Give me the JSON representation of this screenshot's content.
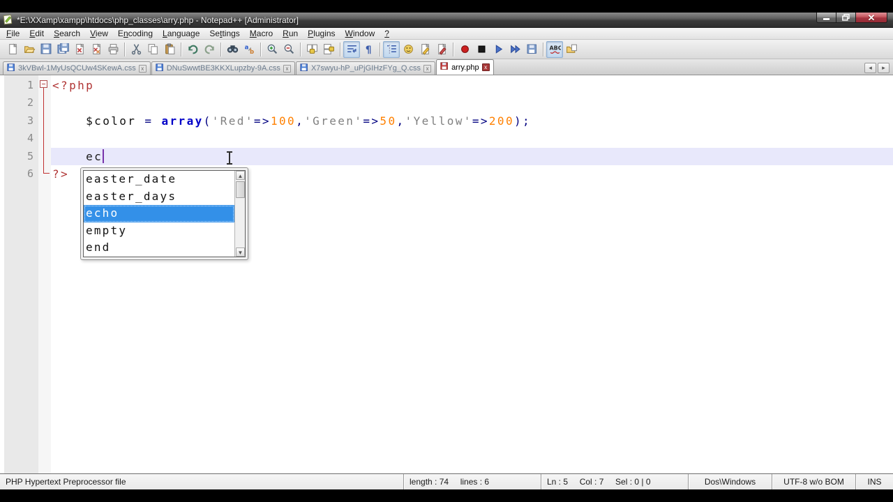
{
  "titlebar": {
    "title": "*E:\\XXamp\\xampp\\htdocs\\php_classes\\arry.php - Notepad++ [Administrator]",
    "buttons": [
      {
        "name": "minimize"
      },
      {
        "name": "restore"
      },
      {
        "name": "close"
      }
    ]
  },
  "menubar": {
    "items": [
      {
        "label": "File",
        "underline_index": 0
      },
      {
        "label": "Edit",
        "underline_index": 0
      },
      {
        "label": "Search",
        "underline_index": 0
      },
      {
        "label": "View",
        "underline_index": 0
      },
      {
        "label": "Encoding",
        "underline_index": 1
      },
      {
        "label": "Language",
        "underline_index": 0
      },
      {
        "label": "Settings",
        "underline_index": 2
      },
      {
        "label": "Macro",
        "underline_index": 0
      },
      {
        "label": "Run",
        "underline_index": 0
      },
      {
        "label": "Plugins",
        "underline_index": 0
      },
      {
        "label": "Window",
        "underline_index": 0
      },
      {
        "label": "?",
        "underline_index": 0
      }
    ]
  },
  "toolbar": {
    "groups": [
      [
        {
          "name": "new-file"
        },
        {
          "name": "open-file"
        },
        {
          "name": "save"
        },
        {
          "name": "save-all"
        },
        {
          "name": "close"
        },
        {
          "name": "close-all"
        },
        {
          "name": "print"
        }
      ],
      [
        {
          "name": "cut"
        },
        {
          "name": "copy"
        },
        {
          "name": "paste"
        }
      ],
      [
        {
          "name": "undo"
        },
        {
          "name": "redo"
        }
      ],
      [
        {
          "name": "find"
        },
        {
          "name": "replace"
        }
      ],
      [
        {
          "name": "zoom-in"
        },
        {
          "name": "zoom-out"
        }
      ],
      [
        {
          "name": "sync-vertical-scroll"
        },
        {
          "name": "sync-horizontal-scroll"
        }
      ],
      [
        {
          "name": "word-wrap",
          "toggled": true
        },
        {
          "name": "show-all-characters"
        }
      ],
      [
        {
          "name": "show-indent-guide",
          "toggled": true
        },
        {
          "name": "user-defined-language"
        },
        {
          "name": "document-map"
        },
        {
          "name": "function-list"
        }
      ],
      [
        {
          "name": "macro-record"
        },
        {
          "name": "macro-stop"
        },
        {
          "name": "macro-play"
        },
        {
          "name": "macro-run-multiple"
        },
        {
          "name": "macro-save"
        }
      ],
      [
        {
          "name": "spell-check",
          "toggled": true
        },
        {
          "name": "document-switcher"
        }
      ]
    ]
  },
  "tabbar": {
    "tabs": [
      {
        "label": "3kVBwl-1MyUsQCUw4SKewA.css",
        "modified": false,
        "active": false
      },
      {
        "label": "DNuSwwtBE3KKXLupzby-9A.css",
        "modified": false,
        "active": false
      },
      {
        "label": "X7swyu-hP_uPjGIHzFYg_Q.css",
        "modified": false,
        "active": false
      },
      {
        "label": "arry.php",
        "modified": true,
        "active": true
      }
    ],
    "close_glyph": "x",
    "scroll_left_glyph": "◂",
    "scroll_right_glyph": "▸"
  },
  "editor": {
    "lines": [
      {
        "num": "1",
        "fold": "box",
        "segments": [
          {
            "text": "<?php",
            "style": "phptag"
          }
        ]
      },
      {
        "num": "2",
        "segments": []
      },
      {
        "num": "3",
        "segments": [
          {
            "text": "    ",
            "style": "plain"
          },
          {
            "text": "$color",
            "style": "var"
          },
          {
            "text": " ",
            "style": "plain"
          },
          {
            "text": "=",
            "style": "op"
          },
          {
            "text": " ",
            "style": "plain"
          },
          {
            "text": "array",
            "style": "kw"
          },
          {
            "text": "(",
            "style": "op"
          },
          {
            "text": "'Red'",
            "style": "str"
          },
          {
            "text": "=>",
            "style": "op"
          },
          {
            "text": "100",
            "style": "num"
          },
          {
            "text": ",",
            "style": "op"
          },
          {
            "text": "'Green'",
            "style": "str"
          },
          {
            "text": "=>",
            "style": "op"
          },
          {
            "text": "50",
            "style": "num"
          },
          {
            "text": ",",
            "style": "op"
          },
          {
            "text": "'Yellow'",
            "style": "str"
          },
          {
            "text": "=>",
            "style": "op"
          },
          {
            "text": "200",
            "style": "num"
          },
          {
            "text": ")",
            "style": "op"
          },
          {
            "text": ";",
            "style": "op"
          }
        ]
      },
      {
        "num": "4",
        "segments": []
      },
      {
        "num": "5",
        "current": true,
        "caret_after": true,
        "segments": [
          {
            "text": "    ec",
            "style": "plain"
          }
        ]
      },
      {
        "num": "6",
        "fold": "end",
        "segments": [
          {
            "text": "?>",
            "style": "phptag"
          }
        ]
      }
    ],
    "autocomplete": {
      "items": [
        "easter_date",
        "easter_days",
        "echo",
        "empty",
        "end"
      ],
      "selected_index": 2,
      "scroll_up_glyph": "▲",
      "scroll_down_glyph": "▼"
    }
  },
  "statusbar": {
    "segments": [
      "PHP Hypertext Preprocessor file",
      "length : 74     lines : 6",
      "Ln : 5     Col : 7     Sel : 0 | 0",
      "Dos\\Windows",
      "UTF-8 w/o BOM",
      "INS"
    ]
  },
  "colors": {
    "selection_blue": "#3390e8",
    "php_tag_red": "#b03434",
    "keyword_blue": "#0000c8",
    "number_orange": "#ff8000",
    "string_gray": "#808080",
    "operator_navy": "#000080",
    "current_line_bg": "#e8e8fb",
    "modified_tab_red": "#c23b3b",
    "saved_tab_blue": "#4a7fd4"
  }
}
